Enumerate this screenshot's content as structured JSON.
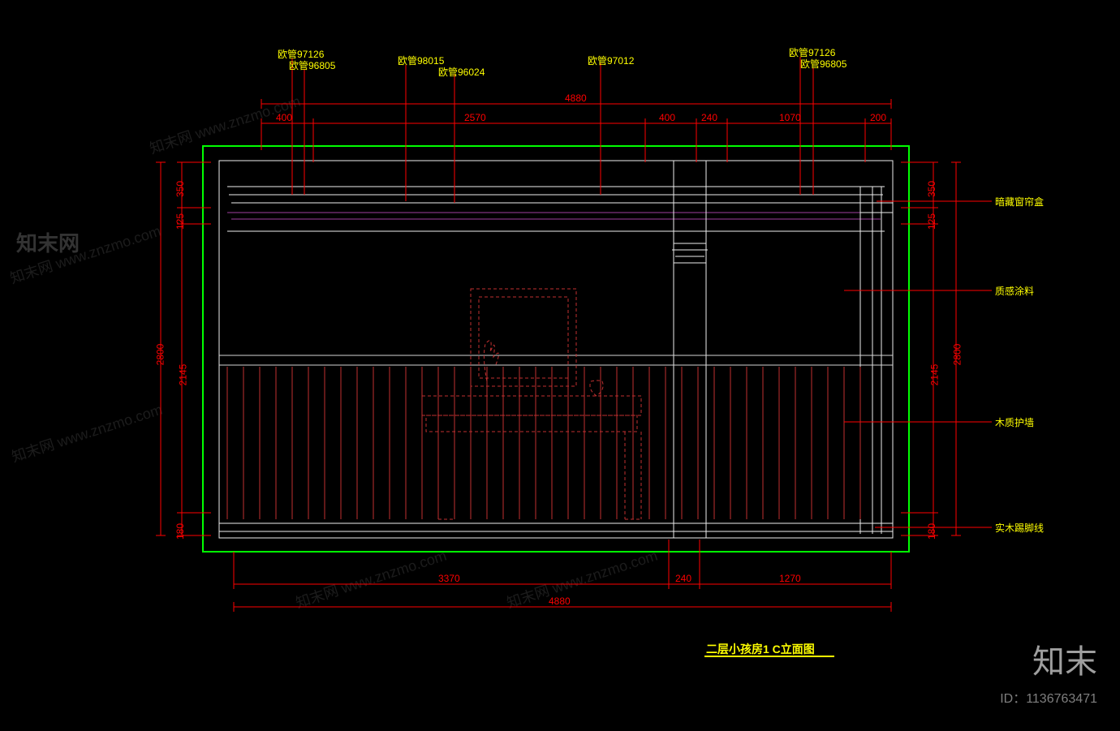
{
  "title": "二层小孩房1 C立面图",
  "id": "ID：1136763471",
  "brand": "知末",
  "watermark": "知末网 www.znzmo.com",
  "top_labels": [
    {
      "k": "l0",
      "v": "欧管97126"
    },
    {
      "k": "l1",
      "v": "欧管96805"
    },
    {
      "k": "l2",
      "v": "欧管98015"
    },
    {
      "k": "l3",
      "v": "欧管96024"
    },
    {
      "k": "l4",
      "v": "欧管97012"
    },
    {
      "k": "l5",
      "v": "欧管97126"
    },
    {
      "k": "l6",
      "v": "欧管96805"
    }
  ],
  "right_labels": [
    {
      "k": "r0",
      "v": "暗藏窗帘盒"
    },
    {
      "k": "r1",
      "v": "质感涂料"
    },
    {
      "k": "r2",
      "v": "木质护墙"
    },
    {
      "k": "r3",
      "v": "实木踢脚线"
    }
  ],
  "dims_top_upper": [
    {
      "k": "tu0",
      "v": "4880"
    }
  ],
  "dims_top_lower": [
    {
      "k": "tl0",
      "v": "400"
    },
    {
      "k": "tl1",
      "v": "2570"
    },
    {
      "k": "tl2",
      "v": "400"
    },
    {
      "k": "tl3",
      "v": "240"
    },
    {
      "k": "tl4",
      "v": "1070"
    },
    {
      "k": "tl5",
      "v": "200"
    }
  ],
  "dims_bottom_upper": [
    {
      "k": "bu0",
      "v": "3370"
    },
    {
      "k": "bu1",
      "v": "240"
    },
    {
      "k": "bu2",
      "v": "1270"
    }
  ],
  "dims_bottom_lower": [
    {
      "k": "bl0",
      "v": "4880"
    }
  ],
  "dims_left_outer": [
    {
      "k": "lo0",
      "v": "2800"
    }
  ],
  "dims_left_inner": [
    {
      "k": "li0",
      "v": "350"
    },
    {
      "k": "li1",
      "v": "125"
    },
    {
      "k": "li2",
      "v": "2145"
    },
    {
      "k": "li3",
      "v": "180"
    }
  ],
  "dims_right_outer": [
    {
      "k": "ro0",
      "v": "2800"
    }
  ],
  "dims_right_inner": [
    {
      "k": "ri0",
      "v": "350"
    },
    {
      "k": "ri1",
      "v": "125"
    },
    {
      "k": "ri2",
      "v": "2145"
    },
    {
      "k": "ri3",
      "v": "180"
    }
  ]
}
